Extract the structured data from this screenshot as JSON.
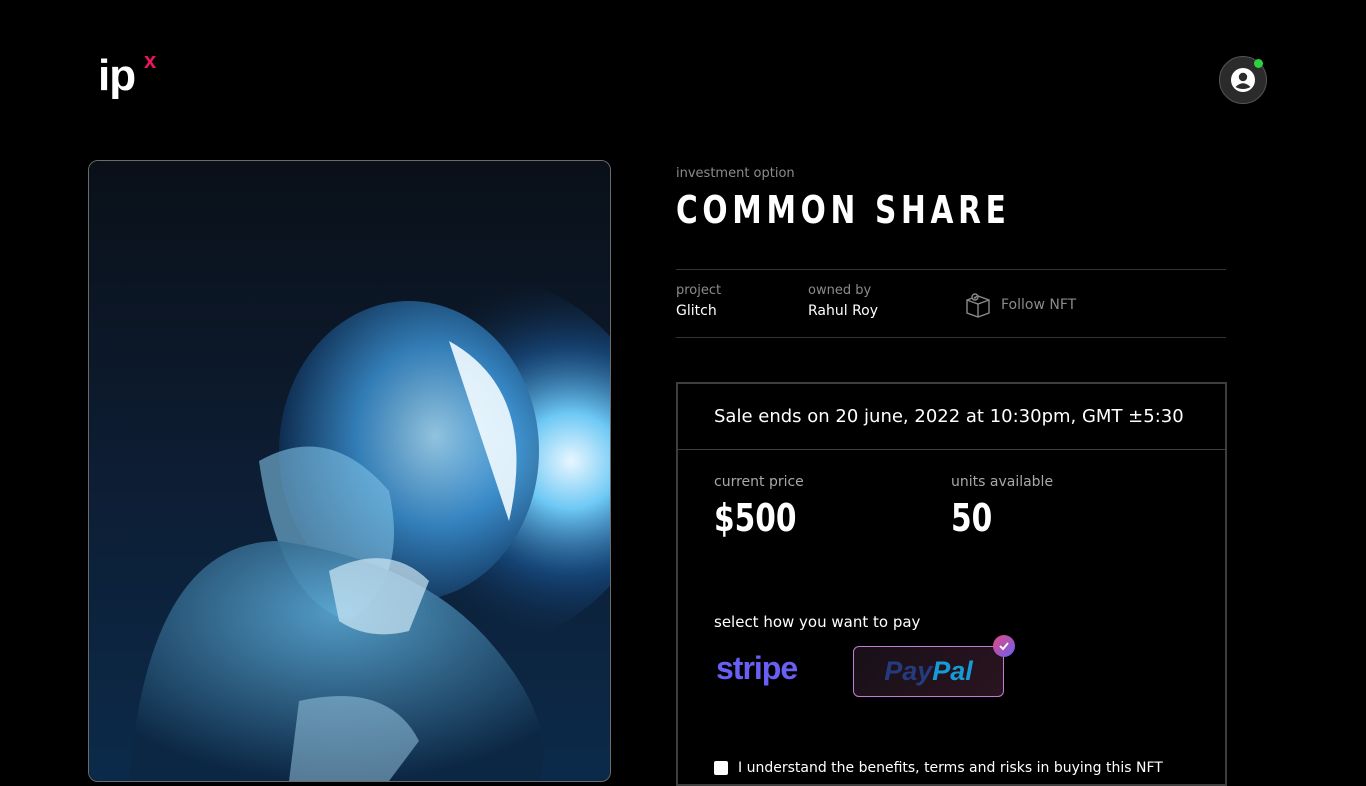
{
  "brand": {
    "logo_text": "ip",
    "logo_superscript": "x",
    "accent": "#e8175d"
  },
  "header": {
    "avatar_icon": "user-avatar-icon",
    "status": "online",
    "status_color": "#2bd33f"
  },
  "nft": {
    "option_label": "investment option",
    "title": "COMMON SHARE",
    "project_label": "project",
    "project_value": "Glitch",
    "owner_label": "owned by",
    "owner_value": "Rahul Roy",
    "follow_label": "Follow NFT",
    "follow_icon": "follow-box-icon",
    "image_alt": "astronaut artwork"
  },
  "sale": {
    "ends_text": "Sale ends on 20 june, 2022 at 10:30pm, GMT ±5:30",
    "price_label": "current price",
    "price_value": "$500",
    "units_label": "units available",
    "units_value": "50",
    "pay_label": "select how you want to pay",
    "methods": [
      {
        "name": "stripe",
        "label": "stripe",
        "selected": false,
        "color": "#6a5ff5"
      },
      {
        "name": "paypal",
        "label_pay": "Pay",
        "label_pal": "Pal",
        "selected": true
      }
    ],
    "terms_text": "I understand the benefits, terms and risks in buying this NFT"
  }
}
